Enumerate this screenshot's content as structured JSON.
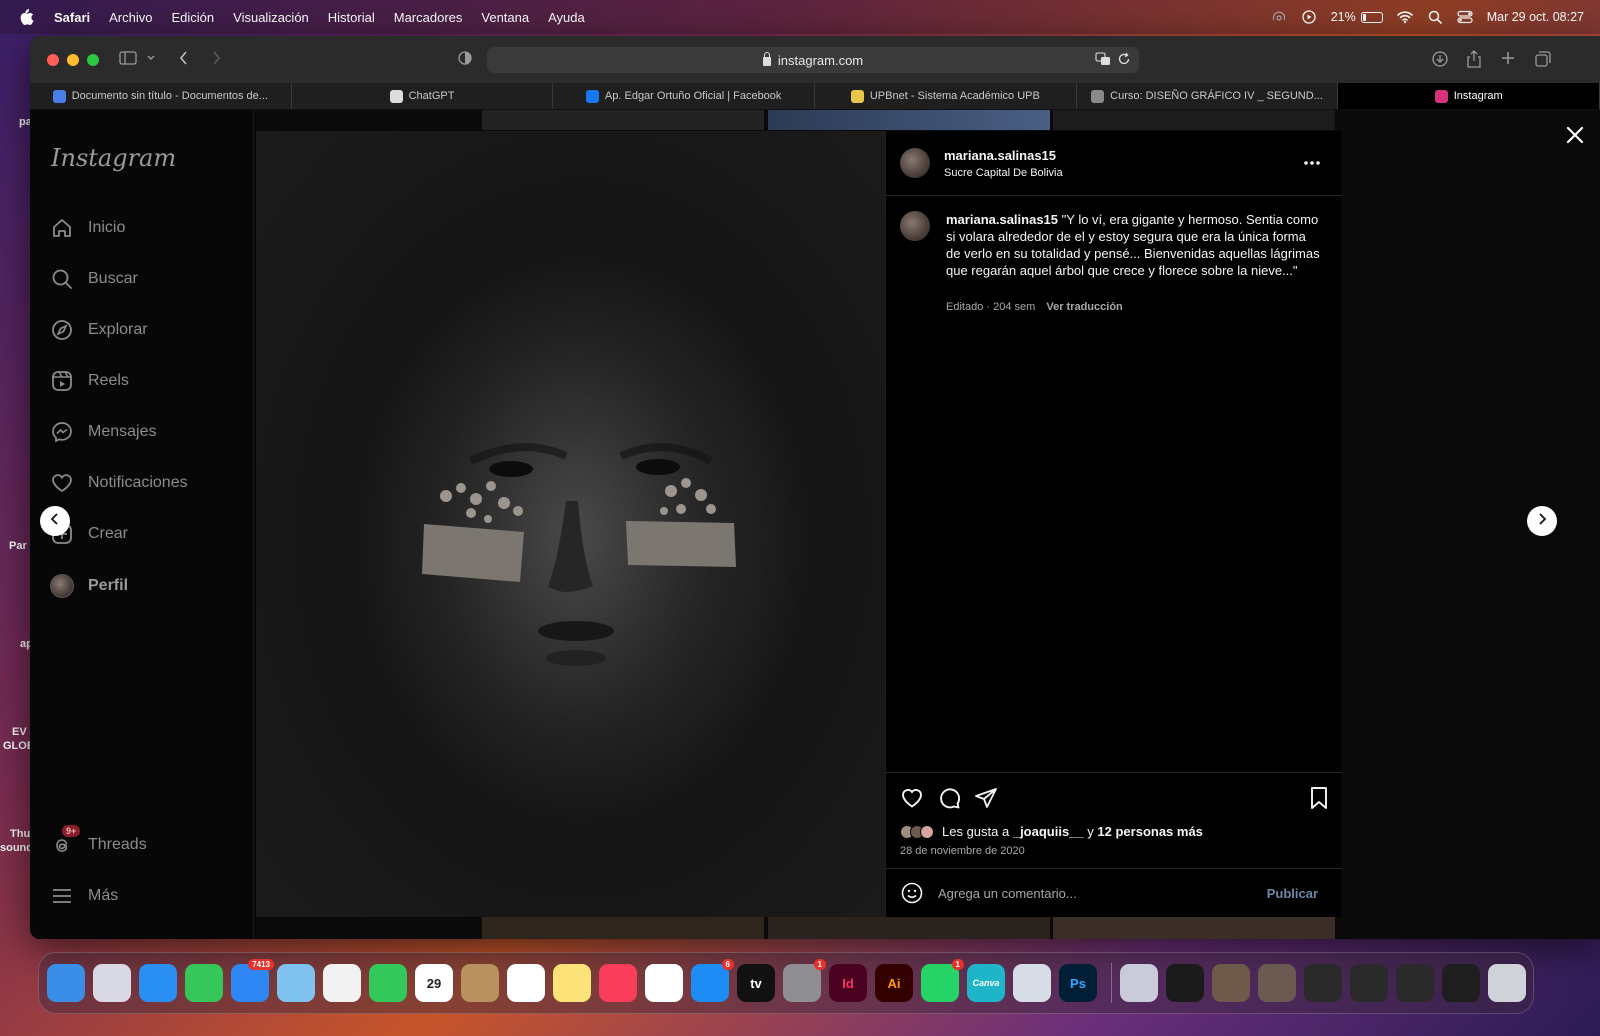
{
  "menubar": {
    "app": "Safari",
    "items": [
      "Archivo",
      "Edición",
      "Visualización",
      "Historial",
      "Marcadores",
      "Ventana",
      "Ayuda"
    ],
    "battery_label": "21%",
    "battery_level": 0.21,
    "datetime": "Mar 29 oct. 08:27"
  },
  "desktop": {
    "labels": [
      "pa",
      "Par",
      "ap",
      "EV",
      "GLOE",
      "Thu",
      "sound"
    ]
  },
  "browser": {
    "url": "instagram.com",
    "tabs": [
      {
        "title": "Documento sin título - Documentos de...",
        "icon": "docs-icon",
        "color": "#4a7ee8"
      },
      {
        "title": "ChatGPT",
        "icon": "chatgpt-icon",
        "color": "#ddd"
      },
      {
        "title": "Ap. Edgar Ortuño Oficial | Facebook",
        "icon": "facebook-icon",
        "color": "#1877f2"
      },
      {
        "title": "UPBnet - Sistema Académico UPB",
        "icon": "upb-icon",
        "color": "#e9c64a"
      },
      {
        "title": "Curso: DISEÑO GRÁFICO IV _ SEGUND...",
        "icon": "u-icon",
        "color": "#8a8a8a"
      },
      {
        "title": "Instagram",
        "icon": "instagram-icon",
        "color": "#d6337c"
      }
    ]
  },
  "instagram": {
    "logo": "Instagram",
    "nav": [
      {
        "label": "Inicio",
        "icon": "home-icon"
      },
      {
        "label": "Buscar",
        "icon": "search-icon"
      },
      {
        "label": "Explorar",
        "icon": "compass-icon"
      },
      {
        "label": "Reels",
        "icon": "reels-icon"
      },
      {
        "label": "Mensajes",
        "icon": "messenger-icon"
      },
      {
        "label": "Notificaciones",
        "icon": "heart-icon"
      },
      {
        "label": "Crear",
        "icon": "plus-square-icon"
      },
      {
        "label": "Perfil",
        "icon": "profile-avatar"
      }
    ],
    "threads": {
      "label": "Threads",
      "badge": "9+"
    },
    "more": {
      "label": "Más"
    },
    "post": {
      "username": "mariana.salinas15",
      "location": "Sucre Capital De Bolivia",
      "caption_user": "mariana.salinas15",
      "caption_text": "\"Y lo ví, era gigante y hermoso. Sentia como si volara alrededor de el y estoy segura que era la única forma de verlo en su totalidad y pensé... Bienvenidas aquellas lágrimas que regarán aquel árbol que crece y florece sobre la nieve...\"",
      "meta": "Editado · 204 sem",
      "translate": "Ver traducción",
      "likes_prefix": "Les gusta a",
      "likes_user": "_joaquiis__",
      "likes_and": "y",
      "likes_rest": "12 personas más",
      "date": "28 de noviembre de 2020",
      "comment_placeholder": "Agrega un comentario...",
      "publish": "Publicar"
    }
  },
  "dock": {
    "apps": [
      {
        "name": "finder-icon",
        "color": "#3b8ee8",
        "text": ""
      },
      {
        "name": "launchpad-icon",
        "color": "#d9d9e6",
        "text": ""
      },
      {
        "name": "safari-icon",
        "color": "#2a8ff2",
        "text": ""
      },
      {
        "name": "messages-icon",
        "color": "#35c759",
        "text": ""
      },
      {
        "name": "mail-icon",
        "color": "#2f86f5",
        "text": "",
        "badge": "7413"
      },
      {
        "name": "maps-icon",
        "color": "#7fc2f0",
        "text": ""
      },
      {
        "name": "photos-icon",
        "color": "#f2f2f2",
        "text": ""
      },
      {
        "name": "facetime-icon",
        "color": "#34c759",
        "text": ""
      },
      {
        "name": "calendar-icon",
        "color": "#ffffff",
        "text": "29"
      },
      {
        "name": "contacts-icon",
        "color": "#b8925e",
        "text": ""
      },
      {
        "name": "reminders-icon",
        "color": "#ffffff",
        "text": ""
      },
      {
        "name": "notes-icon",
        "color": "#fbe37a",
        "text": ""
      },
      {
        "name": "music-icon",
        "color": "#fa3d5a",
        "text": ""
      },
      {
        "name": "freeform-icon",
        "color": "#ffffff",
        "text": ""
      },
      {
        "name": "appstore-icon",
        "color": "#1e8cf5",
        "text": "",
        "badge": "6"
      },
      {
        "name": "appletv-icon",
        "color": "#111111",
        "text": "tv"
      },
      {
        "name": "settings-icon",
        "color": "#8e8e93",
        "text": "",
        "badge": "1"
      },
      {
        "name": "indesign-icon",
        "color": "#49021f",
        "text": "Id"
      },
      {
        "name": "illustrator-icon",
        "color": "#330000",
        "text": "Ai"
      },
      {
        "name": "whatsapp-icon",
        "color": "#25d366",
        "text": "",
        "badge": "1"
      },
      {
        "name": "canva-icon",
        "color": "#1fb5c9",
        "text": "Canva"
      },
      {
        "name": "preview-icon",
        "color": "#d7dde6",
        "text": ""
      },
      {
        "name": "photoshop-icon",
        "color": "#001e36",
        "text": "Ps"
      }
    ],
    "recent": [
      {
        "name": "recent-window-1-icon",
        "color": "#c9ccd8"
      },
      {
        "name": "recent-window-2-icon",
        "color": "#1b1b1b"
      },
      {
        "name": "recent-window-3-icon",
        "color": "#6e5a4a"
      },
      {
        "name": "recent-window-4-icon",
        "color": "#6b5a52"
      },
      {
        "name": "recent-window-5-icon",
        "color": "#2a2a2a"
      },
      {
        "name": "recent-window-6-icon",
        "color": "#2a2a2a"
      },
      {
        "name": "recent-window-7-icon",
        "color": "#2a2a2a"
      },
      {
        "name": "recent-window-8-icon",
        "color": "#1e1e1e"
      }
    ],
    "trash": {
      "name": "trash-icon",
      "color": "#cfd3d8"
    }
  }
}
